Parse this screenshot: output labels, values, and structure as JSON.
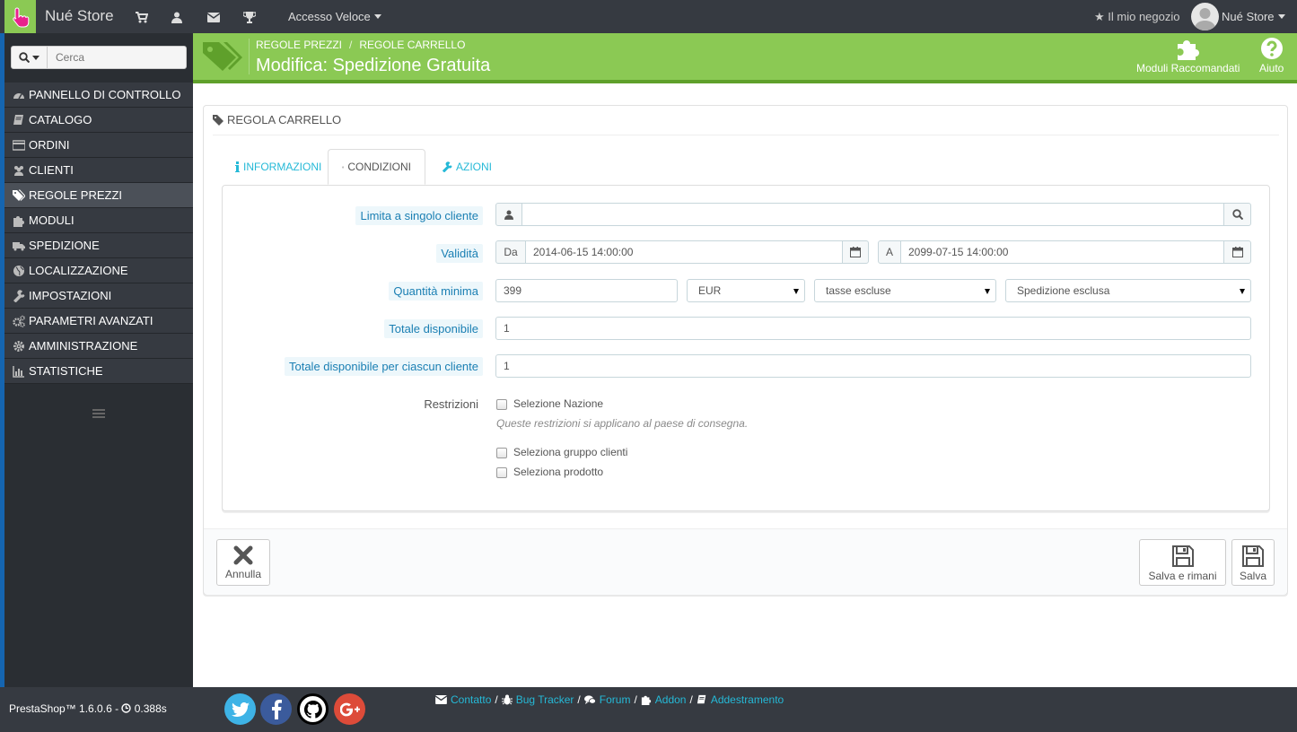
{
  "topbar": {
    "store_name": "Nué Store",
    "quick_access": "Accesso Veloce",
    "my_store": "Il mio negozio",
    "profile_name": "Nué Store",
    "icons": [
      "cart-icon",
      "user-icon",
      "mail-icon",
      "trophy-icon"
    ]
  },
  "sidebar": {
    "search_placeholder": "Cerca",
    "items": [
      {
        "label": "PANNELLO DI CONTROLLO",
        "icon": "dashboard-icon"
      },
      {
        "label": "CATALOGO",
        "icon": "book-icon"
      },
      {
        "label": "ORDINI",
        "icon": "credit-card-icon"
      },
      {
        "label": "CLIENTI",
        "icon": "users-icon"
      },
      {
        "label": "REGOLE PREZZI",
        "icon": "tags-icon",
        "active": true
      },
      {
        "label": "MODULI",
        "icon": "puzzle-icon"
      },
      {
        "label": "SPEDIZIONE",
        "icon": "truck-icon"
      },
      {
        "label": "LOCALIZZAZIONE",
        "icon": "globe-icon"
      },
      {
        "label": "IMPOSTAZIONI",
        "icon": "wrench-icon"
      },
      {
        "label": "PARAMETRI AVANZATI",
        "icon": "cogs-icon"
      },
      {
        "label": "AMMINISTRAZIONE",
        "icon": "cog-icon"
      },
      {
        "label": "STATISTICHE",
        "icon": "bar-chart-icon"
      }
    ]
  },
  "header": {
    "breadcrumb": [
      "REGOLE PREZZI",
      "REGOLE CARRELLO"
    ],
    "title": "Modifica: Spedizione Gratuita",
    "recommended_modules": "Moduli Raccomandati",
    "help": "Aiuto",
    "accent_color": "#8bc954"
  },
  "panel": {
    "heading": "REGOLA CARRELLO",
    "tabs": [
      {
        "label": "INFORMAZIONI",
        "icon": "info-icon"
      },
      {
        "label": "CONDIZIONI",
        "icon": "shuffle-icon",
        "active": true
      },
      {
        "label": "AZIONI",
        "icon": "wrench-icon"
      }
    ],
    "form": {
      "customer_label": "Limita a singolo cliente",
      "customer_value": "",
      "validity_label": "Validità",
      "from_prefix": "Da",
      "from_value": "2014-06-15 14:00:00",
      "to_prefix": "A",
      "to_value": "2099-07-15 14:00:00",
      "min_qty_label": "Quantità minima",
      "min_qty_value": "399",
      "currency": "EUR",
      "tax": "tasse escluse",
      "shipping": "Spedizione esclusa",
      "total_label": "Totale disponibile",
      "total_value": "1",
      "per_customer_label": "Totale disponibile per ciascun cliente",
      "per_customer_value": "1",
      "restrictions_label": "Restrizioni",
      "country_restriction": "Selezione Nazione",
      "country_help": "Queste restrizioni si applicano al paese di consegna.",
      "group_restriction": "Seleziona gruppo clienti",
      "product_restriction": "Seleziona prodotto"
    },
    "buttons": {
      "cancel": "Annulla",
      "save_stay": "Salva e rimani",
      "save": "Salva"
    }
  },
  "footer": {
    "version": "PrestaShop™ 1.6.0.6 - ",
    "timing": "0.388s",
    "links": [
      "Contatto",
      "Bug Tracker",
      "Forum",
      "Addon",
      "Addestramento"
    ],
    "social": [
      "twitter-icon",
      "facebook-icon",
      "github-icon",
      "google-plus-icon"
    ]
  }
}
